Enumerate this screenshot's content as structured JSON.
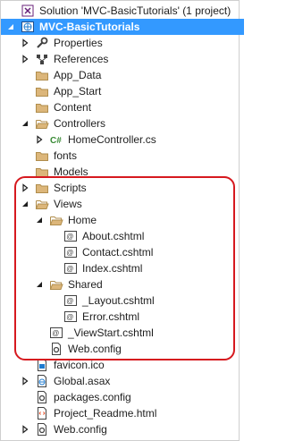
{
  "tree": [
    {
      "label": "Solution 'MVC-BasicTutorials' (1 project)",
      "icon": "solution-icon",
      "depth": 0,
      "arrow": "none"
    },
    {
      "label": "MVC-BasicTutorials",
      "icon": "web-project-icon",
      "depth": 0,
      "arrow": "expanded",
      "selected": true
    },
    {
      "label": "Properties",
      "icon": "wrench-icon",
      "depth": 1,
      "arrow": "collapsed"
    },
    {
      "label": "References",
      "icon": "references-icon",
      "depth": 1,
      "arrow": "collapsed"
    },
    {
      "label": "App_Data",
      "icon": "folder-icon",
      "depth": 1,
      "arrow": "none"
    },
    {
      "label": "App_Start",
      "icon": "folder-icon",
      "depth": 1,
      "arrow": "none"
    },
    {
      "label": "Content",
      "icon": "folder-icon",
      "depth": 1,
      "arrow": "none"
    },
    {
      "label": "Controllers",
      "icon": "folder-open-icon",
      "depth": 1,
      "arrow": "expanded"
    },
    {
      "label": "HomeController.cs",
      "icon": "csharp-file-icon",
      "depth": 2,
      "arrow": "collapsed"
    },
    {
      "label": "fonts",
      "icon": "folder-icon",
      "depth": 1,
      "arrow": "none"
    },
    {
      "label": "Models",
      "icon": "folder-icon",
      "depth": 1,
      "arrow": "none"
    },
    {
      "label": "Scripts",
      "icon": "folder-icon",
      "depth": 1,
      "arrow": "collapsed"
    },
    {
      "label": "Views",
      "icon": "folder-open-icon",
      "depth": 1,
      "arrow": "expanded"
    },
    {
      "label": "Home",
      "icon": "folder-open-icon",
      "depth": 2,
      "arrow": "expanded"
    },
    {
      "label": "About.cshtml",
      "icon": "razor-file-icon",
      "depth": 3,
      "arrow": "none"
    },
    {
      "label": "Contact.cshtml",
      "icon": "razor-file-icon",
      "depth": 3,
      "arrow": "none"
    },
    {
      "label": "Index.cshtml",
      "icon": "razor-file-icon",
      "depth": 3,
      "arrow": "none"
    },
    {
      "label": "Shared",
      "icon": "folder-open-icon",
      "depth": 2,
      "arrow": "expanded"
    },
    {
      "label": "_Layout.cshtml",
      "icon": "razor-file-icon",
      "depth": 3,
      "arrow": "none"
    },
    {
      "label": "Error.cshtml",
      "icon": "razor-file-icon",
      "depth": 3,
      "arrow": "none"
    },
    {
      "label": "_ViewStart.cshtml",
      "icon": "razor-file-icon",
      "depth": 2,
      "arrow": "none"
    },
    {
      "label": "Web.config",
      "icon": "config-file-icon",
      "depth": 2,
      "arrow": "none"
    },
    {
      "label": "favicon.ico",
      "icon": "image-file-icon",
      "depth": 1,
      "arrow": "none"
    },
    {
      "label": "Global.asax",
      "icon": "global-asax-icon",
      "depth": 1,
      "arrow": "collapsed"
    },
    {
      "label": "packages.config",
      "icon": "config-file-icon",
      "depth": 1,
      "arrow": "none"
    },
    {
      "label": "Project_Readme.html",
      "icon": "html-file-icon",
      "depth": 1,
      "arrow": "none"
    },
    {
      "label": "Web.config",
      "icon": "config-file-icon",
      "depth": 1,
      "arrow": "collapsed"
    }
  ],
  "colors": {
    "selection": "#3399ff",
    "folder": "#dcb67a",
    "highlight_border": "#d6191f"
  }
}
